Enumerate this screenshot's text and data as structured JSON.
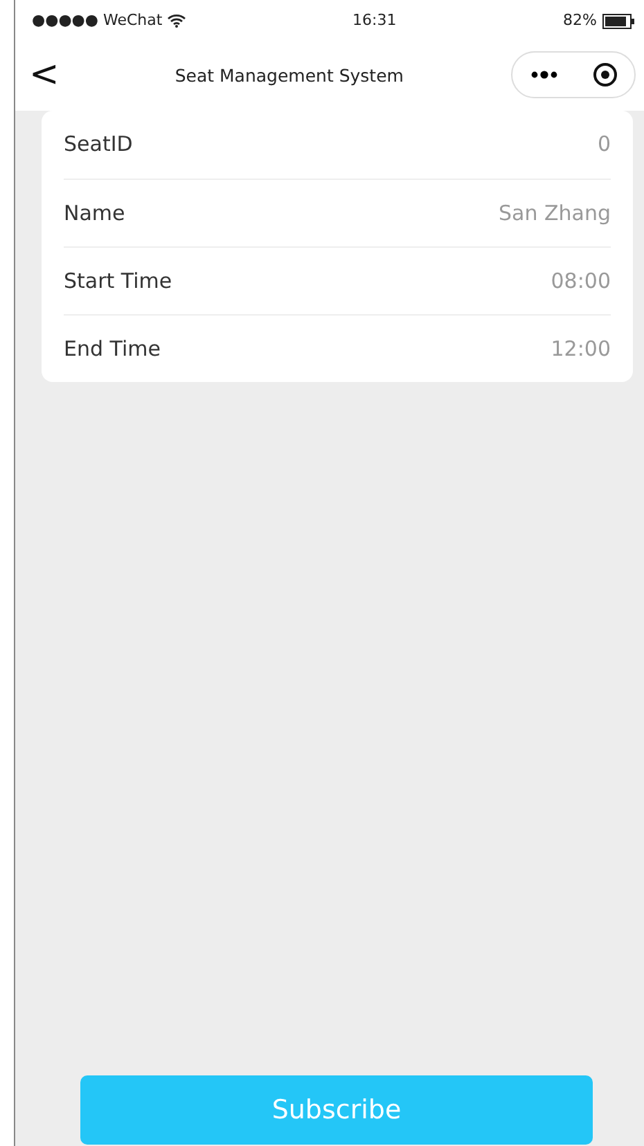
{
  "status_bar": {
    "carrier": "●●●●● WeChat",
    "time": "16:31",
    "battery": "82%"
  },
  "nav_bar": {
    "back": "<",
    "title": "Seat Management System"
  },
  "fields": [
    {
      "label": "SeatID",
      "value": "0"
    },
    {
      "label": "Name",
      "value": "San Zhang"
    },
    {
      "label": "Start Time",
      "value": "08:00"
    },
    {
      "label": "End Time",
      "value": "12:00"
    }
  ],
  "button": {
    "label": "Subscribe"
  }
}
